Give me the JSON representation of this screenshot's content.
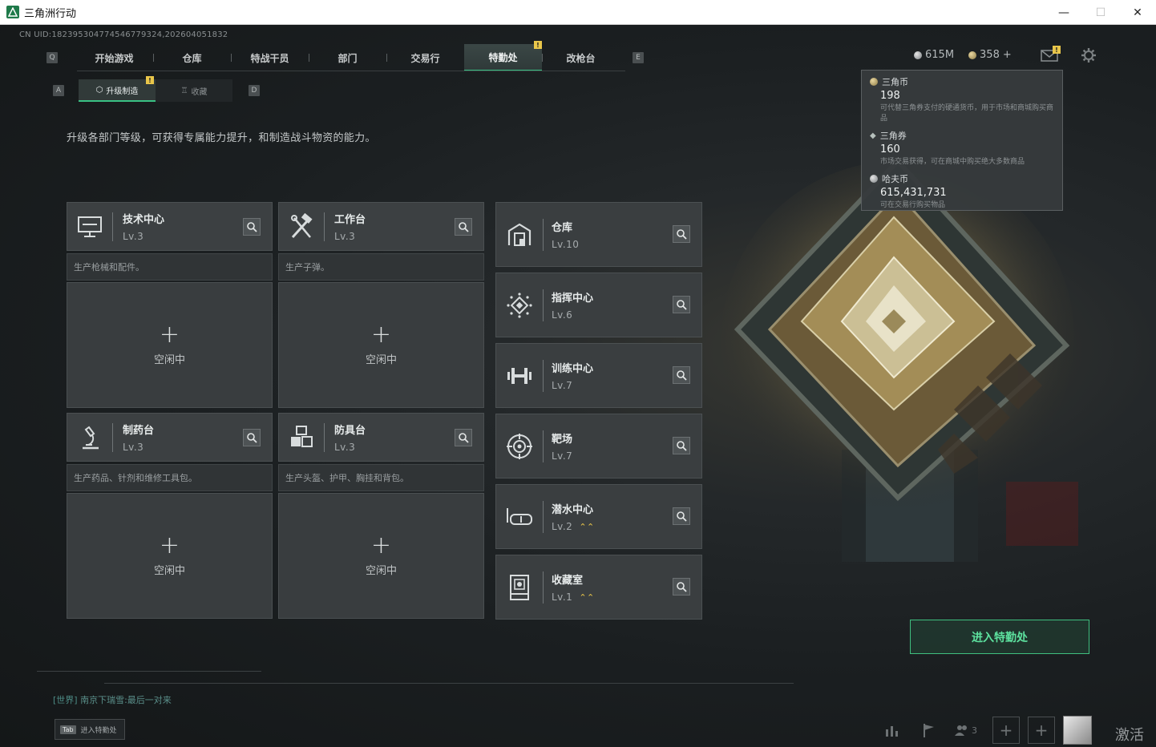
{
  "window": {
    "title": "三角洲行动",
    "minimize": "—",
    "maximize": "☐",
    "close": "✕"
  },
  "uid": "CN UID:182395304774546779324,202604051832",
  "nav": {
    "key_left": "Q",
    "key_right": "E",
    "tabs": [
      {
        "label": "开始游戏"
      },
      {
        "label": "仓库"
      },
      {
        "label": "特战干员"
      },
      {
        "label": "部门"
      },
      {
        "label": "交易行"
      },
      {
        "label": "特勤处",
        "active": true,
        "badge": "!"
      },
      {
        "label": "改枪台"
      }
    ]
  },
  "currencies": {
    "haf": "615M",
    "coin": "358",
    "plus": "+"
  },
  "mail_badge": "!",
  "subnav": {
    "key_left": "A",
    "key_right": "D",
    "tabs": [
      {
        "label": "升级制造",
        "active": true,
        "badge": "!"
      },
      {
        "label": "收藏"
      }
    ]
  },
  "description": "升级各部门等级，可获得专属能力提升，和制造战斗物资的能力。",
  "workshops": [
    {
      "name": "技术中心",
      "level": "Lv.3",
      "desc": "生产枪械和配件。",
      "plus": "+",
      "status": "空闲中"
    },
    {
      "name": "工作台",
      "level": "Lv.3",
      "desc": "生产子弹。",
      "plus": "+",
      "status": "空闲中"
    },
    {
      "name": "制药台",
      "level": "Lv.3",
      "desc": "生产药品、针剂和维修工具包。",
      "plus": "+",
      "status": "空闲中"
    },
    {
      "name": "防具台",
      "level": "Lv.3",
      "desc": "生产头盔、护甲、胸挂和背包。",
      "plus": "+",
      "status": "空闲中"
    }
  ],
  "departments": [
    {
      "name": "仓库",
      "level": "Lv.10"
    },
    {
      "name": "指挥中心",
      "level": "Lv.6"
    },
    {
      "name": "训练中心",
      "level": "Lv.7"
    },
    {
      "name": "靶场",
      "level": "Lv.7"
    },
    {
      "name": "潜水中心",
      "level": "Lv.2",
      "upgrade": "⌃⌃"
    },
    {
      "name": "收藏室",
      "level": "Lv.1",
      "upgrade": "⌃⌃"
    }
  ],
  "tooltip": {
    "items": [
      {
        "title": "三角币",
        "value": "198",
        "desc": "可代替三角券支付的硬通货币，用于市场和商城购买商品"
      },
      {
        "title": "三角券",
        "value": "160",
        "desc": "市场交易获得，可在商城中购买绝大多数商品"
      },
      {
        "title": "哈夫币",
        "value": "615,431,731",
        "desc": "可在交易行购买物品"
      }
    ]
  },
  "enter_button": "进入特勤处",
  "chat": {
    "channel": "[世界]",
    "user": "南京下瑞雪",
    "message": ":最后一对来"
  },
  "tab_hint": {
    "key": "Tab",
    "label": "进入特勤处"
  },
  "bottom": {
    "friends_count": "3",
    "add": "+"
  },
  "watermark": "激活",
  "colors": {
    "accent": "#39c184",
    "badge": "#e9c64a",
    "card": "#3c4042"
  }
}
